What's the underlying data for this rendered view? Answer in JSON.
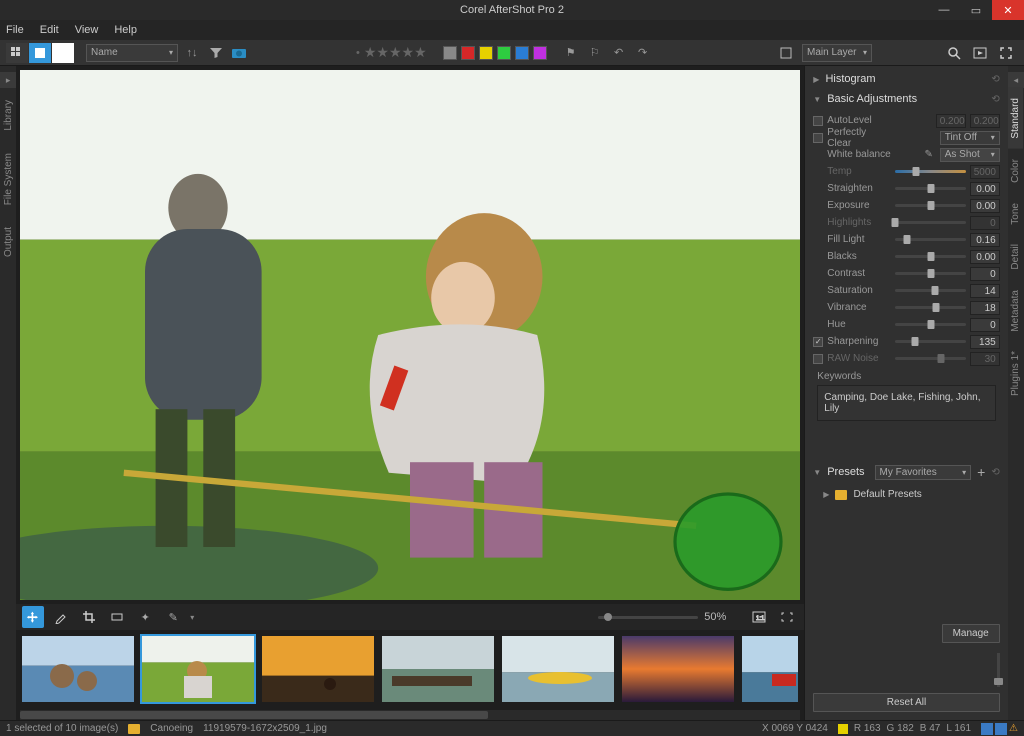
{
  "app_title": "Corel AfterShot Pro 2",
  "menu": [
    "File",
    "Edit",
    "View",
    "Help"
  ],
  "toolbar": {
    "sort_select": "Name",
    "layer_select": "Main Layer"
  },
  "color_tags": [
    "#888",
    "#d62728",
    "#e6d100",
    "#2ecc40",
    "#2a7dd4",
    "#c030e0"
  ],
  "left_tabs": [
    "Library",
    "File System",
    "Output"
  ],
  "right_tabs": [
    "Standard",
    "Color",
    "Tone",
    "Detail",
    "Metadata",
    "Plugins 1*"
  ],
  "sections": {
    "histogram": "Histogram",
    "basic": "Basic Adjustments",
    "presets": "Presets"
  },
  "adjustments": {
    "autolevel": {
      "label": "AutoLevel",
      "val1": "0.200",
      "val2": "0.200"
    },
    "perfectlyclear": {
      "label": "Perfectly Clear",
      "select": "Tint Off"
    },
    "whitebalance": {
      "label": "White balance",
      "select": "As Shot"
    },
    "temp": {
      "label": "Temp",
      "val": "5000",
      "pos": 30
    },
    "straighten": {
      "label": "Straighten",
      "val": "0.00",
      "pos": 50
    },
    "exposure": {
      "label": "Exposure",
      "val": "0.00",
      "pos": 50
    },
    "highlights": {
      "label": "Highlights",
      "val": "0",
      "pos": 0
    },
    "filllight": {
      "label": "Fill Light",
      "val": "0.16",
      "pos": 16
    },
    "blacks": {
      "label": "Blacks",
      "val": "0.00",
      "pos": 50
    },
    "contrast": {
      "label": "Contrast",
      "val": "0",
      "pos": 50
    },
    "saturation": {
      "label": "Saturation",
      "val": "14",
      "pos": 56
    },
    "vibrance": {
      "label": "Vibrance",
      "val": "18",
      "pos": 58
    },
    "hue": {
      "label": "Hue",
      "val": "0",
      "pos": 50
    },
    "sharpening": {
      "label": "Sharpening",
      "val": "135",
      "pos": 28
    },
    "rawnoise": {
      "label": "RAW Noise",
      "val": "30",
      "pos": 65
    }
  },
  "keywords_label": "Keywords",
  "keywords": "Camping, Doe Lake, Fishing, John, Lily",
  "presets_select": "My Favorites",
  "default_presets": "Default Presets",
  "manage_btn": "Manage",
  "reset_all": "Reset All",
  "zoom": "50%",
  "status": {
    "selection": "1 selected of 10 image(s)",
    "catalog": "Canoeing",
    "file": "11919579-1672x2509_1.jpg",
    "coords": "X 0069  Y 0424",
    "r": "R    163",
    "g": "G    182",
    "b": "B    47",
    "l": "L    161"
  }
}
